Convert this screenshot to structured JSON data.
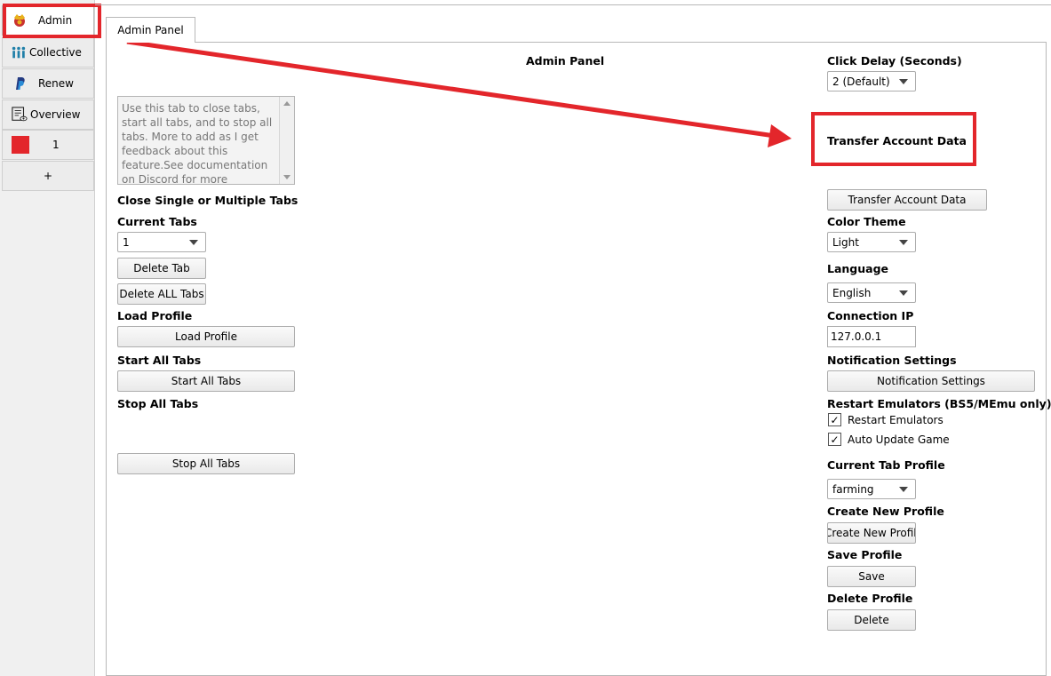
{
  "sidebar": {
    "items": [
      {
        "label": "Admin",
        "icon": "admin-crest-icon"
      },
      {
        "label": "Collective",
        "icon": "people-icon"
      },
      {
        "label": "Renew",
        "icon": "paypal-icon"
      },
      {
        "label": "Overview",
        "icon": "list-eye-icon"
      },
      {
        "label": "1",
        "icon": "red-square-icon",
        "color": "#e3262b"
      },
      {
        "label": "+"
      }
    ]
  },
  "tab": {
    "label": "Admin Panel"
  },
  "main": {
    "heading": "Admin Panel",
    "description": "Use this tab to close tabs, start all tabs, and to stop all tabs. More to add as I get feedback about this feature.See documentation on Discord for more information.",
    "close_tabs_label": "Close Single or Multiple Tabs",
    "current_tabs_label": "Current Tabs",
    "current_tabs_value": "1",
    "delete_tab_button": "Delete Tab",
    "delete_all_tabs_button": "Delete ALL Tabs",
    "load_profile_label": "Load Profile",
    "load_profile_button": "Load Profile",
    "start_all_label": "Start All Tabs",
    "start_all_button": "Start All Tabs",
    "stop_all_label": "Stop All Tabs",
    "stop_all_button": "Stop All Tabs"
  },
  "settings": {
    "click_delay_label": "Click Delay (Seconds)",
    "click_delay_value": "2 (Default)",
    "transfer_heading": "Transfer Account Data",
    "transfer_button": "Transfer Account Data",
    "color_theme_label": "Color Theme",
    "color_theme_value": "Light",
    "language_label": "Language",
    "language_value": "English",
    "connection_ip_label": "Connection IP",
    "connection_ip_value": "127.0.0.1",
    "notification_label": "Notification Settings",
    "notification_button": "Notification Settings",
    "restart_label": "Restart Emulators (BS5/MEmu only)",
    "restart_checkbox": {
      "label": "Restart Emulators",
      "checked": true
    },
    "auto_update_checkbox": {
      "label": "Auto Update Game",
      "checked": true
    },
    "current_profile_label": "Current Tab Profile",
    "current_profile_value": "farming",
    "create_profile_label": "Create New Profile",
    "create_profile_button": "Create New Profile",
    "save_profile_label": "Save Profile",
    "save_button": "Save",
    "delete_profile_label": "Delete Profile",
    "delete_button": "Delete"
  },
  "colors": {
    "annotation": "#e3262b"
  }
}
